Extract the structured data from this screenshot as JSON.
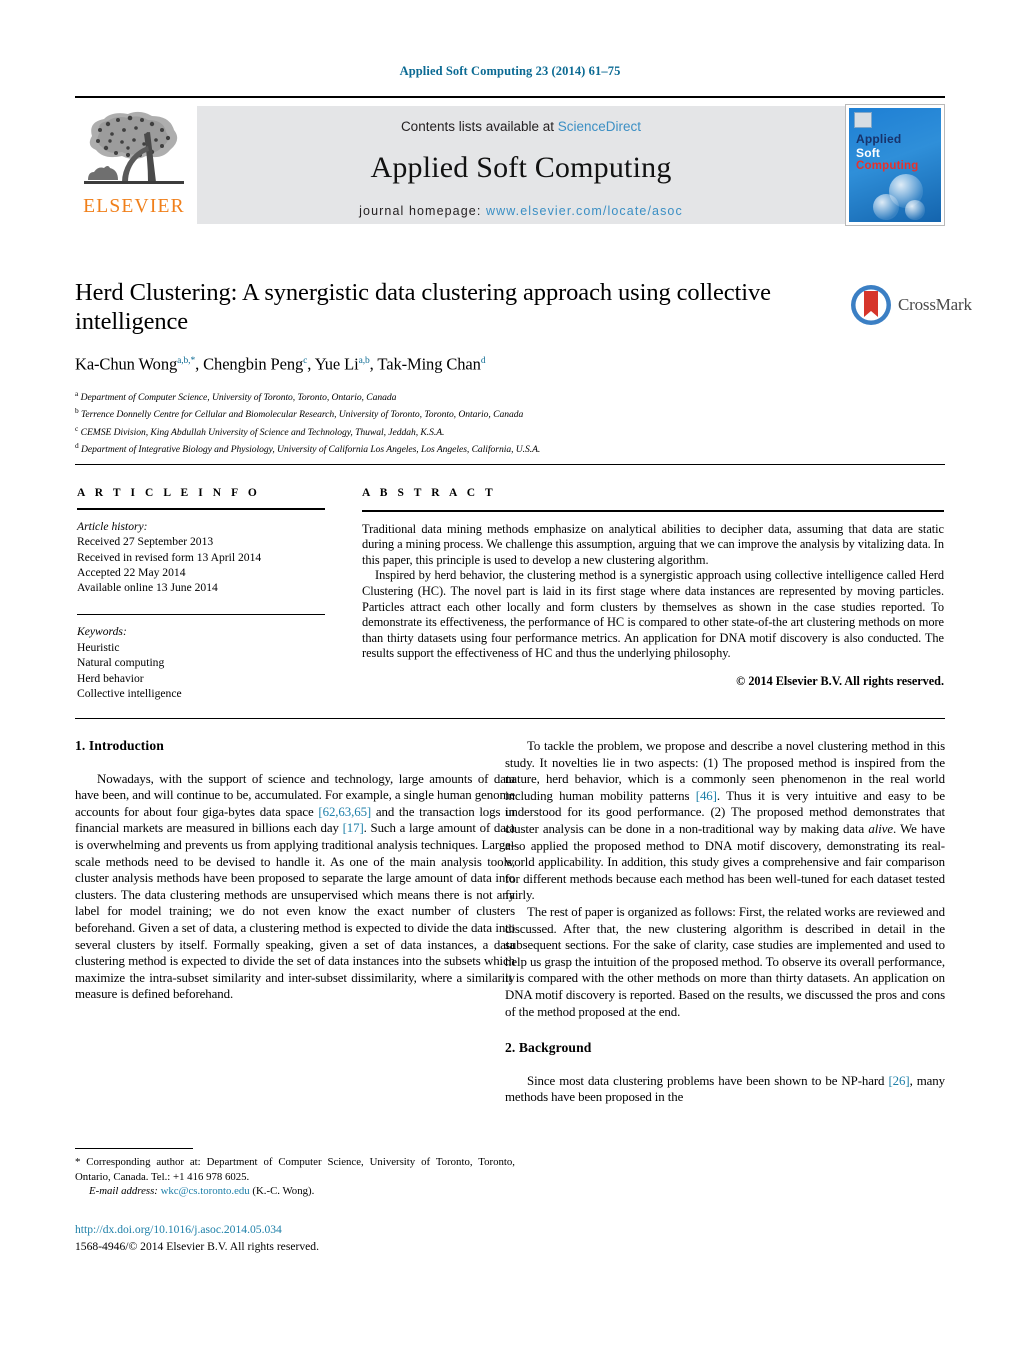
{
  "running_head": "Applied Soft Computing 23 (2014) 61–75",
  "masthead": {
    "contents_prefix": "Contents lists available at ",
    "sciencedirect": "ScienceDirect",
    "journal_title": "Applied Soft Computing",
    "homepage_prefix": "journal homepage:",
    "homepage_url": "www.elsevier.com/locate/asoc",
    "publisher_word": "ELSEVIER",
    "cover": {
      "line1": "Applied",
      "line2": "Soft",
      "line3": "Computing"
    }
  },
  "crossmark": {
    "label": "CrossMark"
  },
  "title": "Herd Clustering: A synergistic data clustering approach using collective intelligence",
  "authors": [
    {
      "name": "Ka-Chun Wong",
      "sup": "a,b,*"
    },
    {
      "name": "Chengbin Peng",
      "sup": "c"
    },
    {
      "name": "Yue Li",
      "sup": "a,b"
    },
    {
      "name": "Tak-Ming Chan",
      "sup": "d"
    }
  ],
  "affiliations": [
    {
      "marker": "a",
      "text": "Department of Computer Science, University of Toronto, Toronto, Ontario, Canada"
    },
    {
      "marker": "b",
      "text": "Terrence Donnelly Centre for Cellular and Biomolecular Research, University of Toronto, Toronto, Ontario, Canada"
    },
    {
      "marker": "c",
      "text": "CEMSE Division, King Abdullah University of Science and Technology, Thuwal, Jeddah, K.S.A."
    },
    {
      "marker": "d",
      "text": "Department of Integrative Biology and Physiology, University of California Los Angeles, Los Angeles, California, U.S.A."
    }
  ],
  "article_info": {
    "heading": "A R T I C L E    I N F O",
    "history_label": "Article history:",
    "history": [
      "Received 27 September 2013",
      "Received in revised form 13 April 2014",
      "Accepted 22 May 2014",
      "Available online 13 June 2014"
    ],
    "keywords_label": "Keywords:",
    "keywords": [
      "Heuristic",
      "Natural computing",
      "Herd behavior",
      "Collective intelligence"
    ]
  },
  "abstract": {
    "heading": "A B S T R A C T",
    "paragraph1": "Traditional data mining methods emphasize on analytical abilities to decipher data, assuming that data are static during a mining process. We challenge this assumption, arguing that we can improve the analysis by vitalizing data. In this paper, this principle is used to develop a new clustering algorithm.",
    "paragraph2": "Inspired by herd behavior, the clustering method is a synergistic approach using collective intelligence called Herd Clustering (HC). The novel part is laid in its first stage where data instances are represented by moving particles. Particles attract each other locally and form clusters by themselves as shown in the case studies reported. To demonstrate its effectiveness, the performance of HC is compared to other state-of-the art clustering methods on more than thirty datasets using four performance metrics. An application for DNA motif discovery is also conducted. The results support the effectiveness of HC and thus the underlying philosophy.",
    "copyright": "© 2014 Elsevier B.V. All rights reserved."
  },
  "body": {
    "section1_heading": "1.  Introduction",
    "left_p1_a": "Nowadays, with the support of science and technology, large amounts of data have been, and will continue to be, accumulated. For example, a single human genome accounts for about four giga-bytes data space ",
    "left_p1_cite1": "[62,63,65]",
    "left_p1_b": " and the transaction logs in financial markets are measured in billions each day ",
    "left_p1_cite2": "[17]",
    "left_p1_c": ". Such a large amount of data is overwhelming and prevents us from applying traditional analysis techniques. Large-scale methods need to be devised to handle it. As one of the main analysis tools, cluster analysis methods have been proposed to separate the large amount of data into clusters. The data clustering methods are unsupervised which means there is not any label for model training; we do not even know the exact number of clusters beforehand. Given a set of data, a clustering method is expected to divide the data into several clusters by itself. Formally speaking, given a set of data instances, a data clustering method is expected to divide the set of data instances into the subsets which maximize the intra-subset similarity and inter-subset dissimilarity, where a similarity measure is defined beforehand.",
    "right_p1_a": "To tackle the problem, we propose and describe a novel clustering method in this study. It novelties lie in two aspects: (1) The proposed method is inspired from the nature, herd behavior, which is a commonly seen phenomenon in the real world including human mobility patterns ",
    "right_p1_cite": "[46]",
    "right_p1_b": ". Thus it is very intuitive and easy to be understood for its good performance. (2) The proposed method demonstrates that cluster analysis can be done in a non-traditional way by making data ",
    "right_p1_italic": "alive",
    "right_p1_c": ". We have also applied the proposed method to DNA motif discovery, demonstrating its real-world applicability. In addition, this study gives a comprehensive and fair comparison for different methods because each method has been well-tuned for each dataset tested fairly.",
    "right_p2": "The rest of paper is organized as follows: First, the related works are reviewed and discussed. After that, the new clustering algorithm is described in detail in the subsequent sections. For the sake of clarity, case studies are implemented and used to help us grasp the intuition of the proposed method. To observe its overall performance, it is compared with the other methods on more than thirty datasets. An application on DNA motif discovery is reported. Based on the results, we discussed the pros and cons of the method proposed at the end.",
    "section2_heading": "2.  Background",
    "right_p3_a": "Since most data clustering problems have been shown to be NP-hard ",
    "right_p3_cite": "[26]",
    "right_p3_b": ", many methods have been proposed in the"
  },
  "footnote": {
    "corresponding": "*  Corresponding author at: Department of Computer Science, University of Toronto, Toronto, Ontario, Canada. Tel.: +1 416 978 6025.",
    "email_label": "E-mail address:",
    "email": "wkc@cs.toronto.edu",
    "email_suffix": " (K.-C. Wong)."
  },
  "doi": {
    "url": "http://dx.doi.org/10.1016/j.asoc.2014.05.034",
    "issn_line": "1568-4946/© 2014 Elsevier B.V. All rights reserved."
  },
  "colors": {
    "link": "#1d7fa8",
    "header_blue": "#0b6a93",
    "elsevier_orange": "#f07f1a",
    "band_gray": "#e4e5e7"
  }
}
